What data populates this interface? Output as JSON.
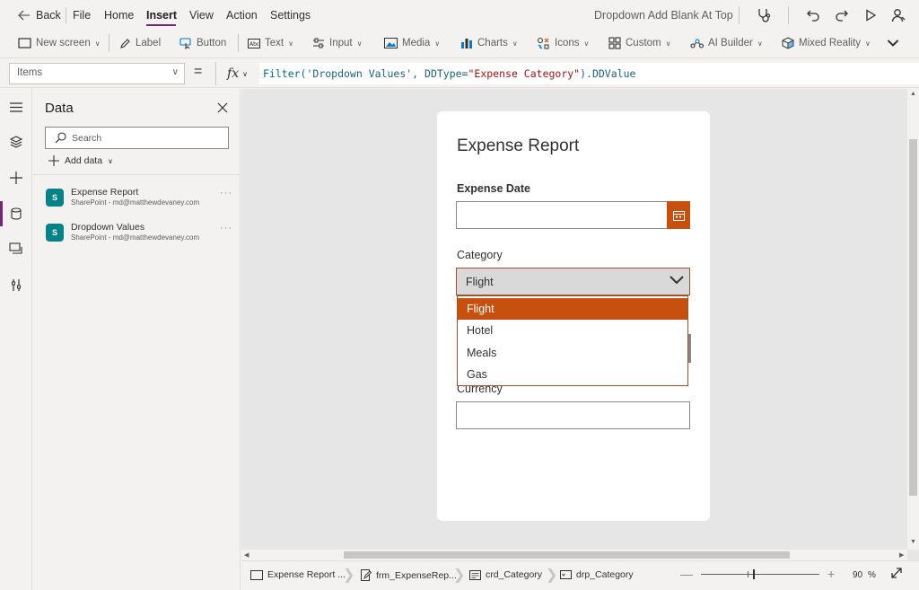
{
  "menubar": {
    "back_label": "Back",
    "items": [
      "File",
      "Home",
      "Insert",
      "View",
      "Action",
      "Settings"
    ],
    "active_item": "Insert",
    "app_name": "Dropdown Add Blank At Top"
  },
  "ribbon": {
    "new_screen": "New screen",
    "label": "Label",
    "button": "Button",
    "text": "Text",
    "input": "Input",
    "media": "Media",
    "charts": "Charts",
    "icons": "Icons",
    "custom": "Custom",
    "ai_builder": "AI Builder",
    "mixed_reality": "Mixed Reality"
  },
  "formula_bar": {
    "property": "Items",
    "equals": "=",
    "fx": "fx",
    "formula": {
      "fn": "Filter(",
      "arg1": "'Dropdown Values'",
      "mid": ", DDType=",
      "arg2": "\"Expense Category\"",
      "tail": ").DDValue"
    }
  },
  "data_panel": {
    "title": "Data",
    "search_placeholder": "Search",
    "add_data": "Add data",
    "sources": [
      {
        "name": "Expense Report",
        "subtitle": "SharePoint - md@matthewdevaney.com"
      },
      {
        "name": "Dropdown Values",
        "subtitle": "SharePoint - md@matthewdevaney.com"
      }
    ],
    "more": "···"
  },
  "app": {
    "title": "Expense Report",
    "expense_date_label": "Expense Date",
    "category_label": "Category",
    "category_value": "Flight",
    "currency_label": "Currency",
    "options": [
      "Flight",
      "Hotel",
      "Meals",
      "Gas"
    ],
    "selected_option": "Flight"
  },
  "status_bar": {
    "crumbs": [
      "Expense Report ...",
      "frm_ExpenseRep...",
      "crd_Category",
      "drp_Category"
    ],
    "zoom_value": "90",
    "zoom_unit": "%"
  },
  "colors": {
    "accent": "#742774",
    "dropdown_selected": "#c7500e",
    "sharepoint": "#038387"
  }
}
